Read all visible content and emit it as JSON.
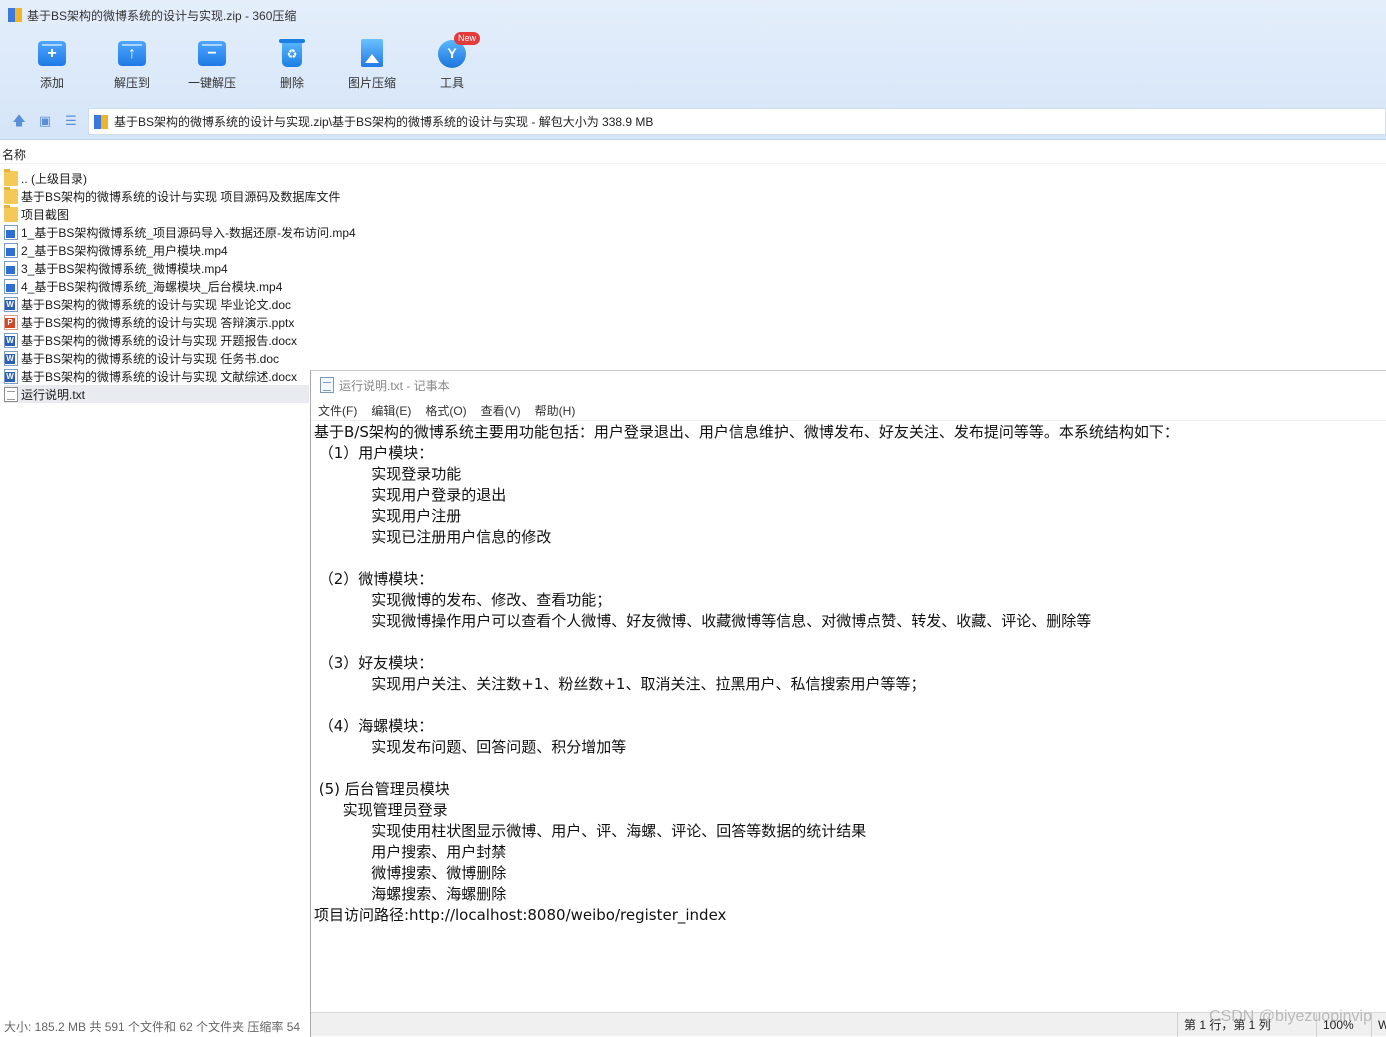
{
  "zip_window": {
    "title": "基于BS架构的微博系统的设计与实现.zip - 360压缩",
    "toolbar": [
      {
        "label": "添加",
        "icon": "add-icon"
      },
      {
        "label": "解压到",
        "icon": "extract-to-icon"
      },
      {
        "label": "一键解压",
        "icon": "one-click-extract-icon"
      },
      {
        "label": "删除",
        "icon": "delete-icon"
      },
      {
        "label": "图片压缩",
        "icon": "image-compress-icon"
      },
      {
        "label": "工具",
        "icon": "tools-icon",
        "badge": "New"
      }
    ],
    "nav_icons": [
      "up-arrow-icon",
      "thumbnail-view-icon",
      "list-view-icon"
    ],
    "path": "基于BS架构的微博系统的设计与实现.zip\\基于BS架构的微博系统的设计与实现 - 解包大小为 338.9 MB",
    "column_header": "名称",
    "files": [
      {
        "name": ".. (上级目录)",
        "type": "folder"
      },
      {
        "name": "基于BS架构的微博系统的设计与实现 项目源码及数据库文件",
        "type": "folder"
      },
      {
        "name": "项目截图",
        "type": "folder"
      },
      {
        "name": "1_基于BS架构微博系统_项目源码导入-数据还原-发布访问.mp4",
        "type": "video"
      },
      {
        "name": "2_基于BS架构微博系统_用户模块.mp4",
        "type": "video"
      },
      {
        "name": "3_基于BS架构微博系统_微博模块.mp4",
        "type": "video"
      },
      {
        "name": "4_基于BS架构微博系统_海螺模块_后台模块.mp4",
        "type": "video"
      },
      {
        "name": "基于BS架构的微博系统的设计与实现 毕业论文.doc",
        "type": "doc"
      },
      {
        "name": "基于BS架构的微博系统的设计与实现 答辩演示.pptx",
        "type": "ppt"
      },
      {
        "name": "基于BS架构的微博系统的设计与实现 开题报告.docx",
        "type": "doc"
      },
      {
        "name": "基于BS架构的微博系统的设计与实现 任务书.doc",
        "type": "doc"
      },
      {
        "name": "基于BS架构的微博系统的设计与实现 文献综述.docx",
        "type": "doc"
      },
      {
        "name": "运行说明.txt",
        "type": "txt",
        "selected": true
      }
    ],
    "status": "大小: 185.2 MB 共 591 个文件和 62 个文件夹 压缩率 54"
  },
  "notepad": {
    "title": "运行说明.txt - 记事本",
    "menu": [
      "文件(F)",
      "编辑(E)",
      "格式(O)",
      "查看(V)",
      "帮助(H)"
    ],
    "lines": [
      "基于B/S架构的微博系统主要用功能包括：用户登录退出、用户信息维护、微博发布、好友关注、发布提问等等。本系统结构如下：",
      " （1）用户模块：",
      "            实现登录功能",
      "            实现用户登录的退出",
      "            实现用户注册",
      "            实现已注册用户信息的修改",
      "",
      " （2）微博模块：",
      "            实现微博的发布、修改、查看功能；",
      "            实现微博操作用户可以查看个人微博、好友微博、收藏微博等信息、对微博点赞、转发、收藏、评论、删除等",
      "",
      " （3）好友模块：",
      "            实现用户关注、关注数+1、粉丝数+1、取消关注、拉黑用户、私信搜索用户等等；",
      "",
      " （4）海螺模块：",
      "            实现发布问题、回答问题、积分增加等",
      "",
      " (5) 后台管理员模块",
      "      实现管理员登录",
      "            实现使用柱状图显示微博、用户、评、海螺、评论、回答等数据的统计结果",
      "            用户搜索、用户封禁",
      "            微博搜索、微博删除",
      "            海螺搜索、海螺删除",
      "项目访问路径:http://localhost:8080/weibo/register_index"
    ],
    "status": {
      "position": "第 1 行，第 1 列",
      "zoom": "100%",
      "eol": "W"
    }
  },
  "watermark": "CSDN @biyezuopinvip"
}
